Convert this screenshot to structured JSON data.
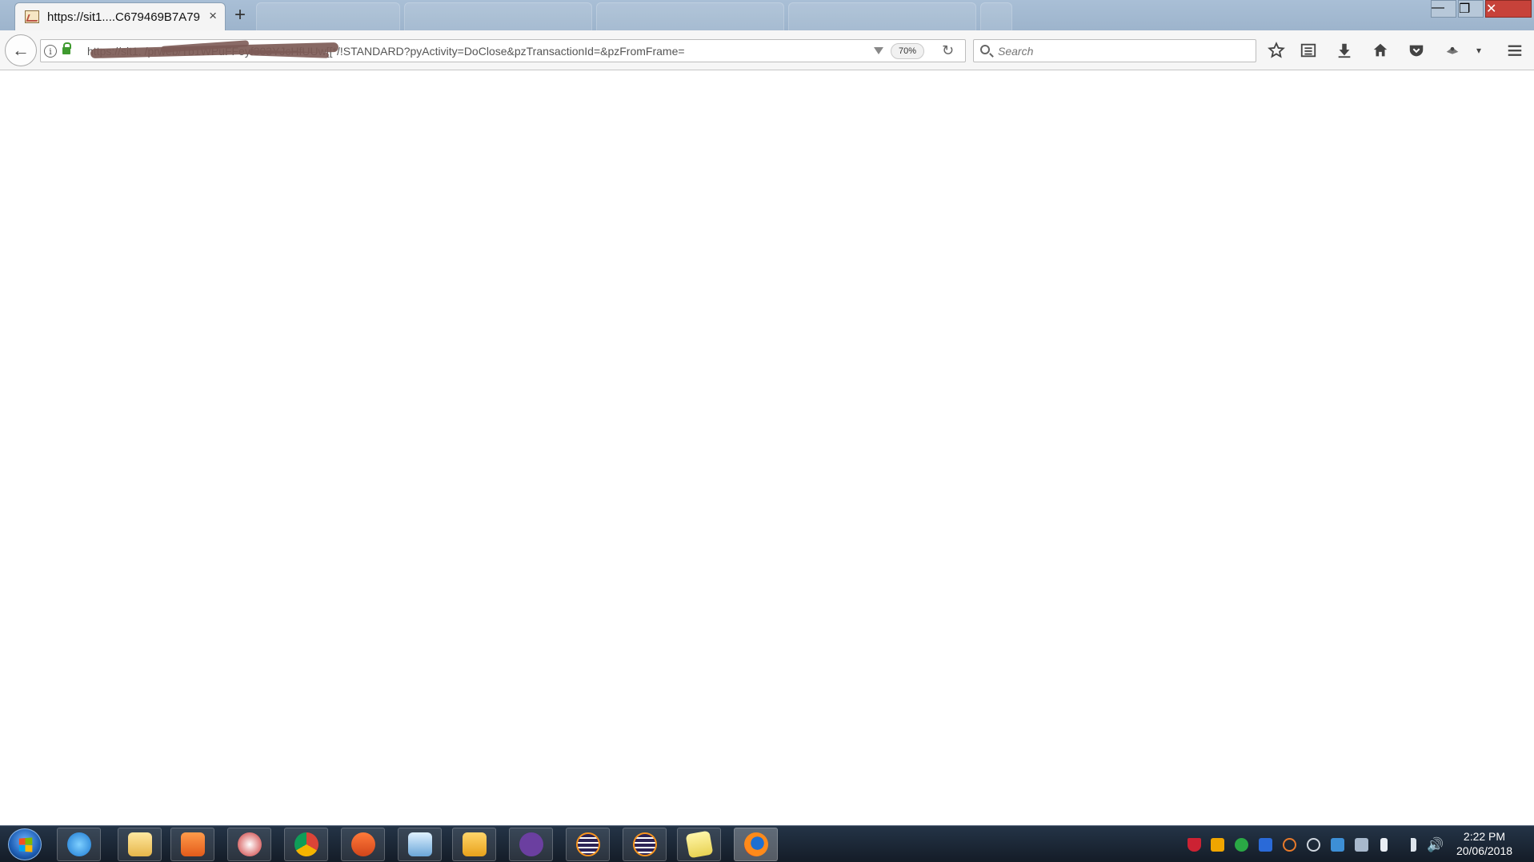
{
  "browser": {
    "tab": {
      "title": "https://sit1....C679469B7A79",
      "close": "×"
    },
    "new_tab_label": "+",
    "window_controls": {
      "minimize": "—",
      "maximize": "❐",
      "close": "✕"
    },
    "url": "https://sit1.                                           /prweb/Tb1WPuFFeyf303YJcHfUUw[[*/!STANDARD?pyActivity=DoClose&pzTransactionId=&pzFromFrame=",
    "zoom": "70%",
    "search_placeholder": "Search"
  },
  "taskbar": {
    "apps": [
      "internet-explorer",
      "file-explorer",
      "media-player",
      "snipping-tool",
      "chrome",
      "pencil-app",
      "remote-desktop",
      "outlook",
      "github",
      "eclipse",
      "eclipse",
      "sticky-notes",
      "firefox"
    ],
    "active_app": "firefox",
    "clock": {
      "time": "2:22 PM",
      "date": "20/06/2018"
    }
  },
  "colors": {
    "taskbar": "#1b2533",
    "tabstrip": "#a9bfd6",
    "close_button": "#c7423a",
    "lock": "#3f9a2f"
  }
}
